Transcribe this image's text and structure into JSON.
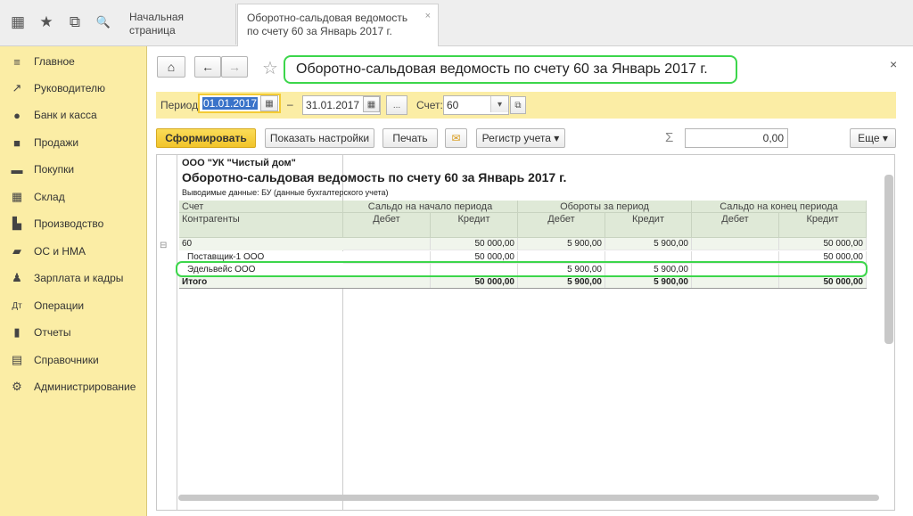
{
  "tabs": {
    "home": "Начальная страница",
    "active": "Оборотно-сальдовая ведомость по счету 60 за Январь 2017 г.",
    "close": "×"
  },
  "topbar": {
    "icons": [
      "grid-icon",
      "star-icon",
      "history-icon",
      "search-icon"
    ],
    "glyphs": [
      "▦",
      "★",
      "⧉",
      "🔍"
    ]
  },
  "sidebar": {
    "items": [
      {
        "label": "Главное",
        "glyph": "≡"
      },
      {
        "label": "Руководителю",
        "glyph": "↗"
      },
      {
        "label": "Банк и касса",
        "glyph": "●"
      },
      {
        "label": "Продажи",
        "glyph": "■"
      },
      {
        "label": "Покупки",
        "glyph": "▬"
      },
      {
        "label": "Склад",
        "glyph": "▦"
      },
      {
        "label": "Производство",
        "glyph": "▙"
      },
      {
        "label": "ОС и НМА",
        "glyph": "▰"
      },
      {
        "label": "Зарплата и кадры",
        "glyph": "♟"
      },
      {
        "label": "Операции",
        "glyph": "Дт"
      },
      {
        "label": "Отчеты",
        "glyph": "▮"
      },
      {
        "label": "Справочники",
        "glyph": "▤"
      },
      {
        "label": "Администрирование",
        "glyph": "⚙"
      }
    ]
  },
  "form": {
    "title": "Оборотно-сальдовая ведомость по счету 60 за Январь 2017 г.",
    "close": "×",
    "home_glyph": "⌂",
    "back_glyph": "←",
    "forward_glyph": "→",
    "star_glyph": "☆",
    "period_label": "Период:",
    "date_from": "01.01.2017",
    "dash": "–",
    "date_to": "31.01.2017",
    "dots": "...",
    "account_label": "Счет:",
    "account_value": "60",
    "generate_button": "Сформировать",
    "settings_button": "Показать настройки",
    "print_button": "Печать",
    "register_button": "Регистр учета",
    "sigma": "Σ",
    "sum_value": "0,00",
    "more_button": "Еще"
  },
  "report": {
    "org": "ООО \"УК \"Чистый дом\"",
    "title": "Оборотно-сальдовая ведомость по счету 60 за Январь 2017 г.",
    "output": "Выводимые данные:  БУ (данные бухгалтерского учета)",
    "h_account": "Счет",
    "h_contractors": "Контрагенты",
    "h_open": "Сальдо на начало периода",
    "h_turn": "Обороты за период",
    "h_close": "Сальдо на конец периода",
    "h_debit": "Дебет",
    "h_credit": "Кредит",
    "rows": [
      {
        "name": "60",
        "v": [
          "",
          "50 000,00",
          "5 900,00",
          "5 900,00",
          "",
          "50 000,00"
        ]
      },
      {
        "name": "Поставщик-1 ООО",
        "v": [
          "",
          "50 000,00",
          "",
          "",
          "",
          "50 000,00"
        ]
      },
      {
        "name": "Эдельвейс ООО",
        "v": [
          "",
          "",
          "5 900,00",
          "5 900,00",
          "",
          ""
        ]
      },
      {
        "name": "Итого",
        "v": [
          "",
          "50 000,00",
          "5 900,00",
          "5 900,00",
          "",
          "50 000,00"
        ]
      }
    ],
    "expander": "⊟"
  },
  "colors": {
    "sidebar": "#fbeda5",
    "accent": "#f4cb33",
    "highlight": "#3cd64b"
  }
}
